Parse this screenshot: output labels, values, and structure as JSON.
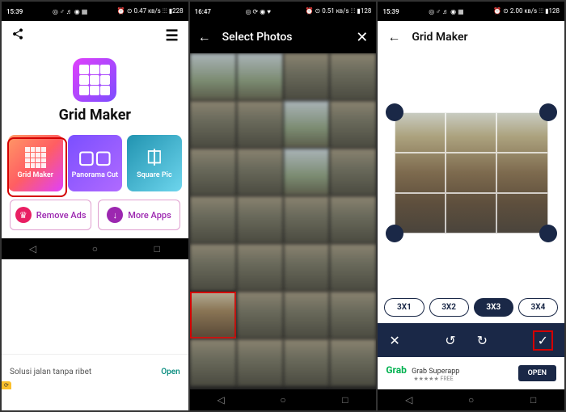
{
  "screen1": {
    "status_time": "15:39",
    "status_icons_app": "◎ ♂ ♬ ◉ ▦",
    "status_icons_sys": "⏰ ⊙ 0.47 ᴋʙ/s ⫶⫶⫶ ▮228",
    "app_title": "Grid Maker",
    "tiles": {
      "grid": "Grid Maker",
      "panorama": "Panorama Cut",
      "square": "Square Pic"
    },
    "remove_ads": "Remove Ads",
    "more_apps": "More Apps",
    "ad_text": "Solusi jalan tanpa ribet",
    "ad_open": "Open",
    "ad_badge": "⟳"
  },
  "screen2": {
    "status_time": "16:47",
    "status_icons_app": "◎ ⟳ ◉ ♥",
    "status_icons_sys": "⏰ ⊙ 0.51 ᴋʙ/s ⫶⫶⫶ ▮128",
    "title": "Select Photos"
  },
  "screen3": {
    "status_time": "15:39",
    "status_icons_app": "◎ ♂ ♬ ◉ ▦",
    "status_icons_sys": "⏰ ⊙ 2.00 ᴋʙ/s ⫶⫶⫶ ▮128",
    "title": "Grid Maker",
    "ratios": [
      "3X1",
      "3X2",
      "3X3",
      "3X4"
    ],
    "ratio_active": "3X3",
    "ad_brand": "Grab",
    "ad_text": "Grab Superapp",
    "ad_sub": "★★★★★ FREE",
    "ad_open": "OPEN"
  }
}
